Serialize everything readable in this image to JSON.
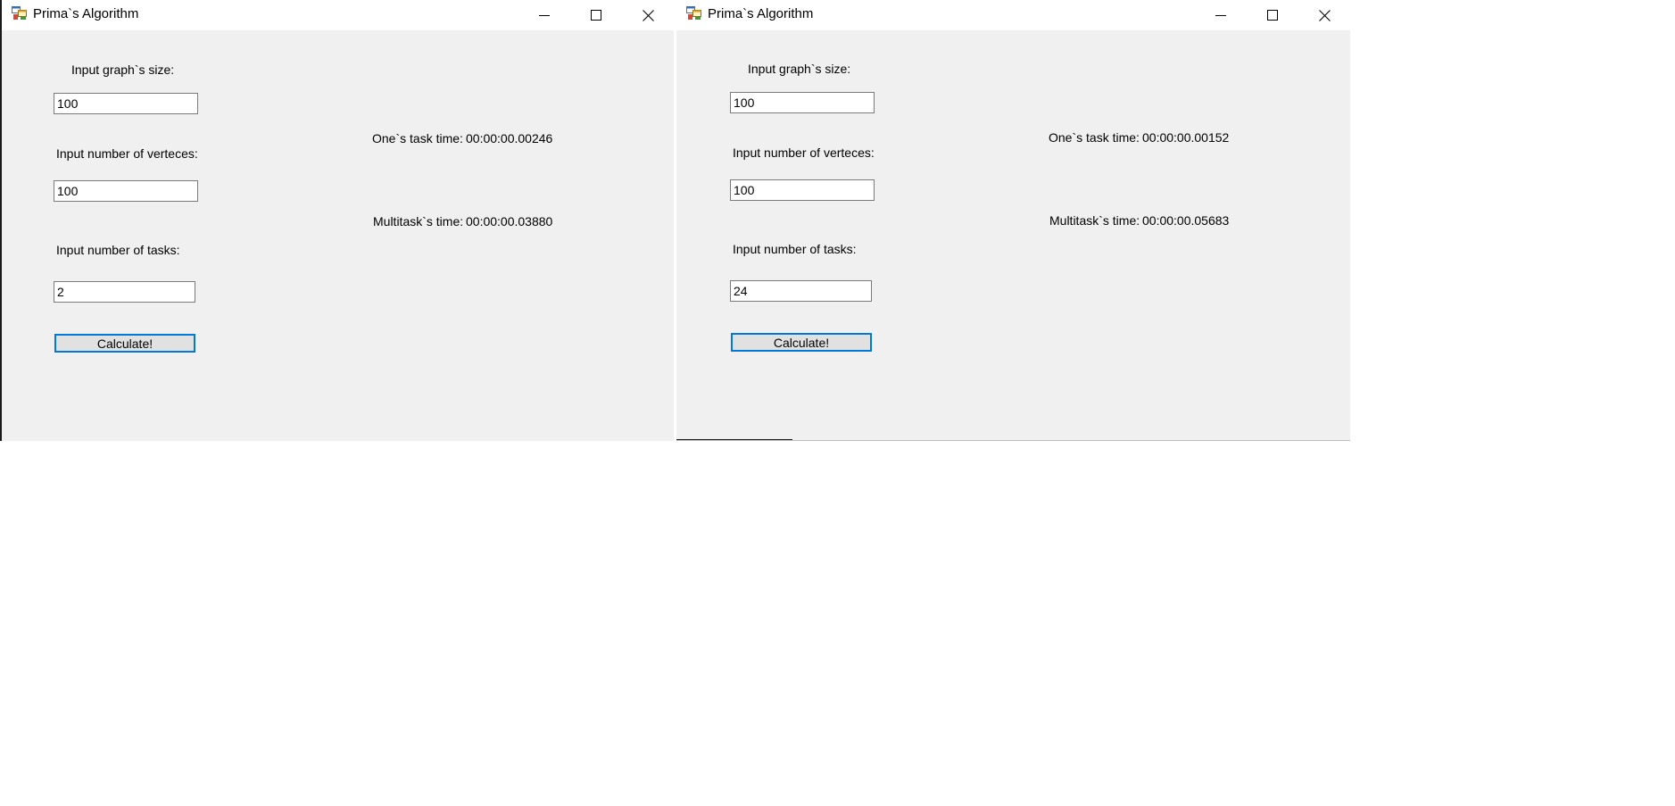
{
  "windows": [
    {
      "title": "Prima`s Algorithm",
      "graph_size_label": "Input graph`s size:",
      "graph_size_value": "100",
      "vertices_label": "Input number of verteces:",
      "vertices_value": "100",
      "tasks_label": "Input number of tasks:",
      "tasks_value": "2",
      "calculate_label": "Calculate!",
      "one_task_label": "One`s task time:",
      "one_task_value": "00:00:00.00246",
      "multitask_label": "Multitask`s time:",
      "multitask_value": "00:00:00.03880"
    },
    {
      "title": "Prima`s Algorithm",
      "graph_size_label": "Input graph`s size:",
      "graph_size_value": "100",
      "vertices_label": "Input number of verteces:",
      "vertices_value": "100",
      "tasks_label": "Input number of tasks:",
      "tasks_value": "24",
      "calculate_label": "Calculate!",
      "one_task_label": "One`s task time:",
      "one_task_value": "00:00:00.00152",
      "multitask_label": "Multitask`s time:",
      "multitask_value": "00:00:00.05683"
    }
  ],
  "icons": {
    "app": "app-form-icon",
    "minimize": "minimize-icon",
    "maximize": "maximize-icon",
    "close": "close-icon"
  },
  "colors": {
    "client_background": "#f0f0f0",
    "titlebar_background": "#ffffff",
    "button_focus_border": "#0078d7",
    "button_face": "#e1e1e1"
  }
}
